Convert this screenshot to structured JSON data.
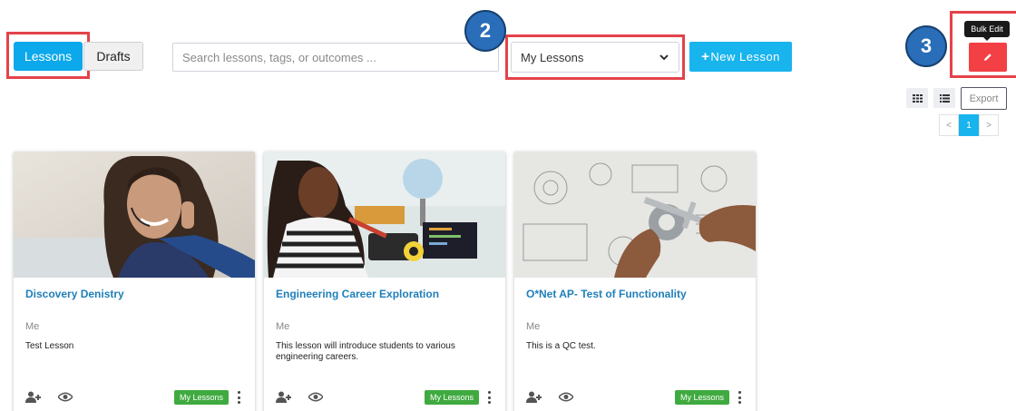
{
  "tabs": {
    "lessons": "Lessons",
    "drafts": "Drafts"
  },
  "search": {
    "placeholder": "Search lessons, tags, or outcomes ..."
  },
  "filter": {
    "selected": "My Lessons"
  },
  "new_lesson": {
    "label": "New Lesson",
    "icon": "plus-icon"
  },
  "steps": {
    "step2": "2",
    "step3": "3"
  },
  "bulk_edit": {
    "tooltip": "Bulk Edit",
    "icon": "pencil-icon"
  },
  "view": {
    "export_label": "Export"
  },
  "pagination": {
    "prev": "<",
    "current": "1",
    "next": ">"
  },
  "colors": {
    "accent": "#18b4ed",
    "highlight": "#e4434a",
    "badge": "#2a6db8",
    "tag": "#3faa3f",
    "title_link": "#1f7fb9",
    "bulk_edit": "#f24045"
  },
  "cards": [
    {
      "title": "Discovery Denistry",
      "author": "Me",
      "description": "Test Lesson",
      "tag": "My Lessons",
      "image": "woman-with-headset-photo"
    },
    {
      "title": "Engineering Career Exploration",
      "author": "Me",
      "description": "This lesson will introduce students to various engineering careers.",
      "tag": "My Lessons",
      "image": "girl-building-robot-photo"
    },
    {
      "title": "O*Net AP- Test of Functionality",
      "author": "Me",
      "description": "This is a QC test.",
      "tag": "My Lessons",
      "image": "hands-with-caliper-photo"
    }
  ]
}
